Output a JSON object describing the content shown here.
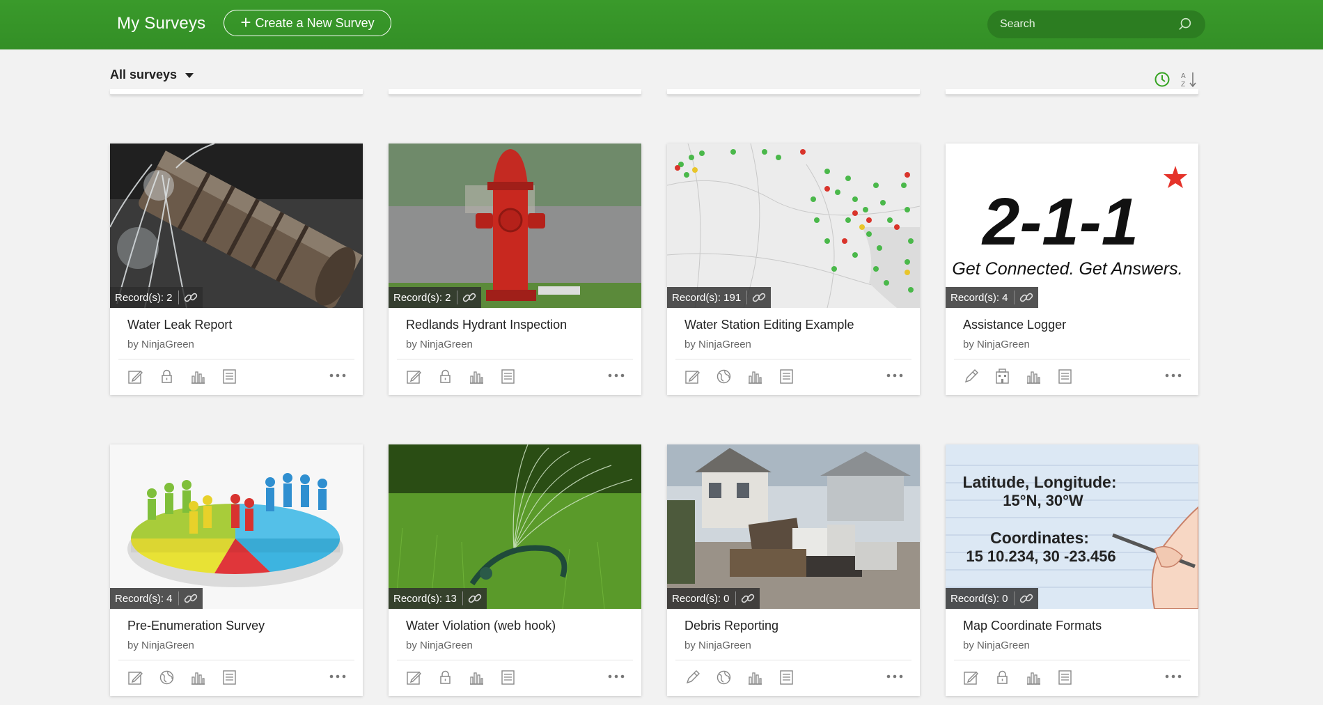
{
  "header": {
    "title": "My Surveys",
    "create_label": "Create a New Survey",
    "search_placeholder": "Search"
  },
  "toolbar": {
    "filter_label": "All surveys",
    "sort_by_date_icon": "clock-icon",
    "sort_alpha_icon": "sort-az-icon"
  },
  "colors": {
    "header": "#35962a",
    "accent": "#35a321"
  },
  "surveys": [
    {
      "title": "Water Leak Report",
      "owner": "by NinjaGreen",
      "records": "Record(s): 2"
    },
    {
      "title": "Redlands Hydrant Inspection",
      "owner": "by NinjaGreen",
      "records": "Record(s): 2"
    },
    {
      "title": "Water Station Editing Example",
      "owner": "by NinjaGreen",
      "records": "Record(s): 191"
    },
    {
      "title": "Assistance Logger",
      "owner": "by NinjaGreen",
      "records": "Record(s): 4"
    },
    {
      "title": "Pre-Enumeration Survey",
      "owner": "by NinjaGreen",
      "records": "Record(s): 4"
    },
    {
      "title": "Water Violation (web hook)",
      "owner": "by NinjaGreen",
      "records": "Record(s): 13"
    },
    {
      "title": "Debris Reporting",
      "owner": "by NinjaGreen",
      "records": "Record(s): 0"
    },
    {
      "title": "Map Coordinate Formats",
      "owner": "by NinjaGreen",
      "records": "Record(s): 0"
    }
  ],
  "thumb_text": {
    "logo_211": "2-1-1",
    "logo_211_tagline": "Get Connected. Get Answers.",
    "coord_line1": "Latitude, Longitude:",
    "coord_line2": "15°N, 30°W",
    "coord_line3": "Coordinates:",
    "coord_line4": "15 10.234, 30 -23.456"
  }
}
